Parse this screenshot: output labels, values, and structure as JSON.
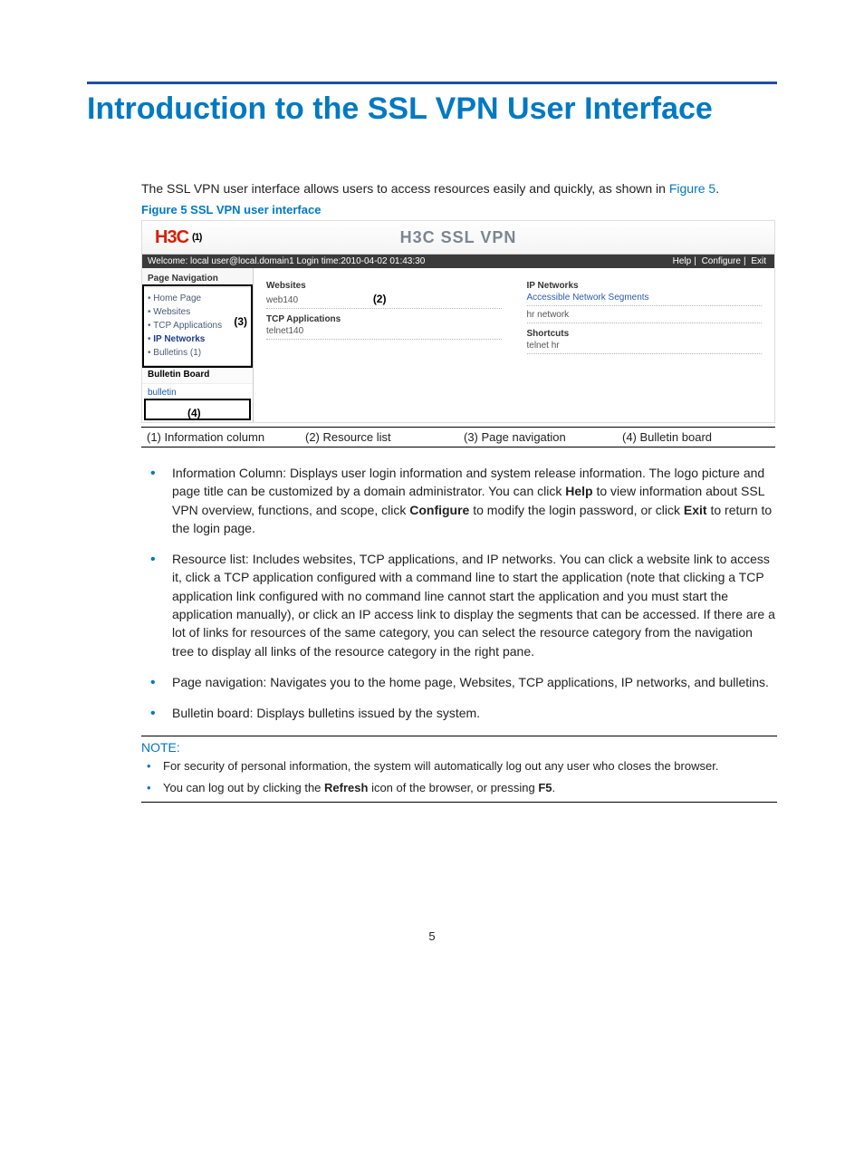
{
  "title": "Introduction to the SSL VPN User Interface",
  "intro_pre": "The SSL VPN user interface allows users to access resources easily and quickly, as shown in ",
  "intro_link": "Figure 5",
  "intro_post": ".",
  "figcap": "Figure 5 SSL VPN user interface",
  "shot": {
    "logo": "H3C",
    "logo_annot": "(1)",
    "title": "H3C  SSL  VPN",
    "welcome": "Welcome: local user@local.domain1    Login time:2010-04-02 01:43:30",
    "links": {
      "help": "Help",
      "configure": "Configure",
      "exit": "Exit"
    },
    "side_head": "Page Navigation",
    "nav": [
      "Home Page",
      "Websites",
      "TCP Applications",
      "IP Networks",
      "Bulletins (1)"
    ],
    "annot3": "(3)",
    "bull_head": "Bulletin Board",
    "bull_item": "bulletin",
    "annot4": "(4)",
    "col1": {
      "s1": "Websites",
      "l1": "web140",
      "annot2": "(2)",
      "s2": "TCP Applications",
      "l2": "telnet140"
    },
    "col2": {
      "s1": "IP Networks",
      "l1": "Accessible Network Segments",
      "l2": "hr network",
      "s2": "Shortcuts",
      "l3": "telnet hr"
    }
  },
  "legend": [
    "(1) Information column",
    "(2) Resource list",
    "(3) Page navigation",
    "(4) Bulletin board"
  ],
  "bullets": {
    "b1a": "Information Column: Displays user login information and system release information. The logo picture and page title can be customized by a domain administrator. You can click ",
    "b1h": "Help",
    "b1b": " to view information about SSL VPN overview, functions, and scope, click ",
    "b1c": "Configure",
    "b1d": " to modify the login password, or click ",
    "b1e": "Exit",
    "b1f": " to return to the login page.",
    "b2": "Resource list: Includes websites, TCP applications, and IP networks. You can click a website link to access it, click a TCP application configured with a command line to start the application (note that clicking a TCP application link configured with no command line cannot start the application and you must start the application manually), or click an IP access link to display the segments that can be accessed. If there are a lot of links for resources of the same category, you can select the resource category from the navigation tree to display all links of the resource category in the right pane.",
    "b3": "Page navigation: Navigates you to the home page, Websites, TCP applications, IP networks, and bulletins.",
    "b4": "Bulletin board: Displays bulletins issued by the system."
  },
  "note_head": "NOTE:",
  "notes": {
    "n1": "For security of personal information, the system will automatically log out any user who closes the browser.",
    "n2a": "You can log out by clicking the ",
    "n2b": "Refresh",
    "n2c": " icon of the browser, or pressing ",
    "n2d": "F5",
    "n2e": "."
  },
  "pagenum": "5"
}
